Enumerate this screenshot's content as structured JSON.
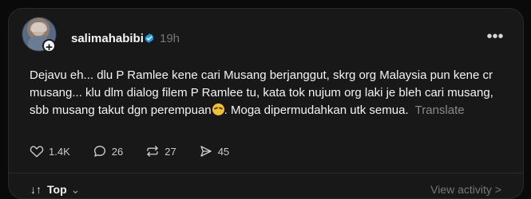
{
  "post": {
    "username": "salimahabibi",
    "time": "19h",
    "more_label": "•••",
    "text_before_emoji": "Dejavu eh... dlu P Ramlee kene cari Musang berjanggut, skrg org Malaysia pun kene cr musang... klu dlm dialog filem P Ramlee tu, kata tok nujum org laki je bleh cari musang, sbb musang takut dgn perempuan",
    "text_after_emoji": ". Moga dipermudahkan utk semua.",
    "translate_label": "Translate"
  },
  "actions": {
    "likes": "1.4K",
    "comments": "26",
    "reposts": "27",
    "shares": "45"
  },
  "footer": {
    "sort_label": "Top",
    "sort_arrows": "↓↑",
    "chevron": "⌄",
    "view_activity": "View activity",
    "view_activity_arrow": ">"
  },
  "colors": {
    "background": "#0a0a0a",
    "card": "#181818",
    "accent": "#1d9bf0",
    "muted": "#777777"
  },
  "icons": {
    "avatar": "profile-avatar",
    "verified": "verified-badge-icon",
    "like": "heart-icon",
    "comment": "comment-bubble-icon",
    "repost": "repost-icon",
    "share": "send-icon",
    "emoji": "embarrassed-emoji"
  }
}
